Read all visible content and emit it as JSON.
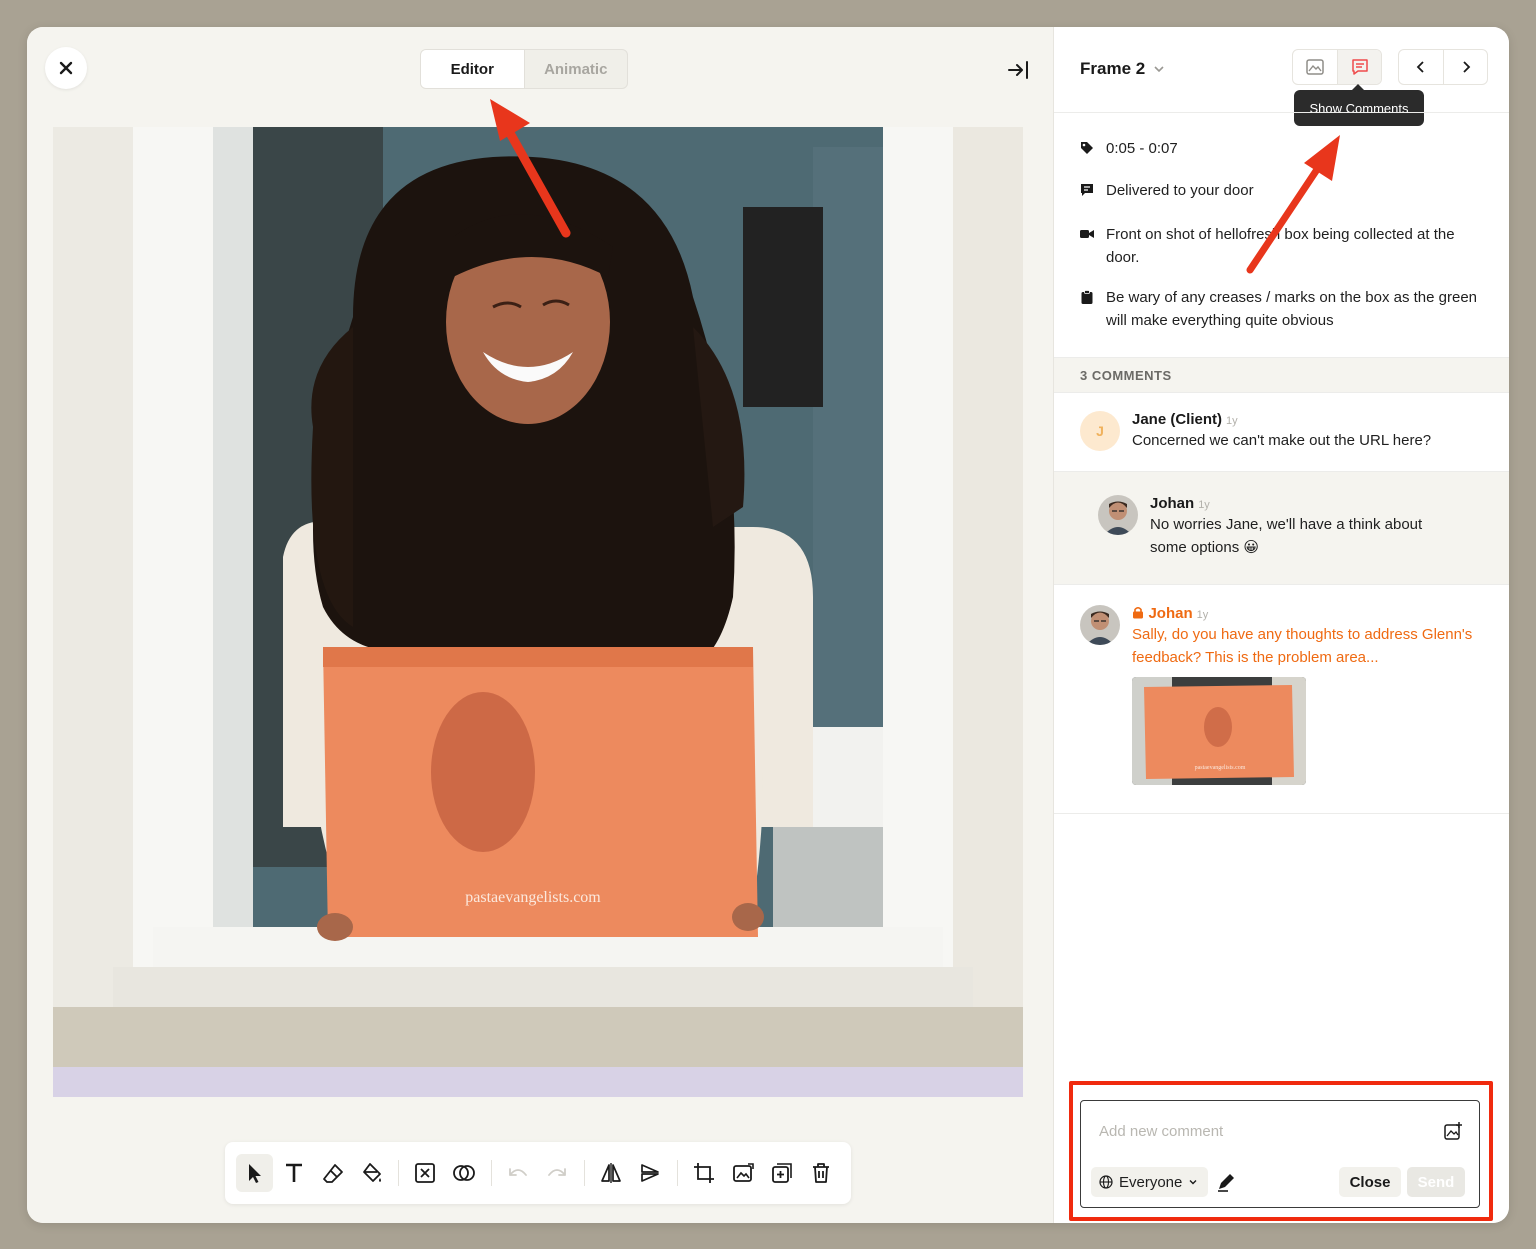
{
  "editor": {
    "tabs": [
      {
        "label": "Editor",
        "active": true
      },
      {
        "label": "Animatic",
        "active": false
      }
    ],
    "photo_caption": "pastaevangelists.com"
  },
  "panel": {
    "frame_title": "Frame 2",
    "tooltip": "Show Comments",
    "meta": {
      "time": "0:05 - 0:07",
      "title": "Delivered to your door",
      "shot": "Front on shot of hellofresh box being collected at the door.",
      "note": "Be wary of any creases / marks on the box as the green will make everything quite obvious"
    },
    "comments_header": "3 COMMENTS",
    "comments": [
      {
        "author": "Jane (Client)",
        "initial": "J",
        "time": "1y",
        "text": "Concerned we can't make out the URL here?"
      },
      {
        "author": "Johan",
        "time": "1y",
        "text": "No worries Jane, we'll have a think about some options 😀"
      },
      {
        "author": "Johan",
        "time": "1y",
        "text": "Sally, do you have any thoughts to address Glenn's feedback? This is the problem area...",
        "private": true,
        "thumb_caption": "pastaevangelists.com"
      }
    ],
    "composer": {
      "placeholder": "Add new comment",
      "audience": "Everyone",
      "close_label": "Close",
      "send_label": "Send"
    }
  },
  "colors": {
    "accent": "#ef6a12",
    "highlight": "#f02a0e",
    "tooltip_bg": "#2b2b2b"
  }
}
